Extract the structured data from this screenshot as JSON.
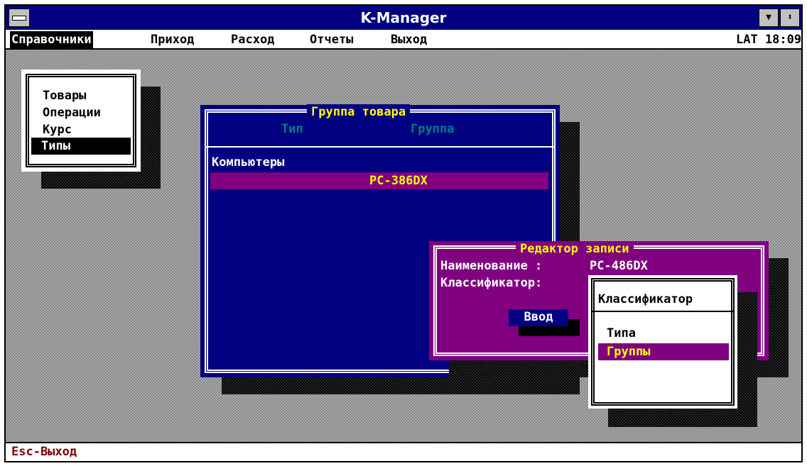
{
  "window": {
    "title": "K-Manager",
    "sys_icon": "system-menu-icon",
    "minimize_icon": "arrow-down-icon",
    "restore_icon": "arrow-updown-icon"
  },
  "menubar": {
    "items": [
      "Справочники",
      "Приход",
      "Расход",
      "Отчеты",
      "Выход"
    ],
    "status": "LAT 18:09"
  },
  "ref_menu": {
    "items": [
      "Товары",
      "Операции",
      "Курс",
      "Типы"
    ],
    "selected": "Типы"
  },
  "group_window": {
    "title": "Группа товара",
    "columns": [
      "Тип",
      "Группа"
    ],
    "rows": [
      {
        "type": "Компьютеры",
        "group": ""
      },
      {
        "type": "",
        "group": "PC-386DX"
      }
    ]
  },
  "editor": {
    "title": "Редактор записи",
    "name_label": "Наименование :",
    "name_value": "PC-486DX",
    "classifier_label": "Классификатор:",
    "enter_button": "Ввод"
  },
  "classifier_popup": {
    "title": "Классификатор",
    "options": [
      "Типа",
      "Группы"
    ],
    "selected": "Группы"
  },
  "statusbar": {
    "text": "Esc-Выход"
  },
  "colors": {
    "title_bar": "#000080",
    "window_blue": "#000080",
    "window_magenta": "#800080",
    "highlight_yellow": "#ffff00",
    "header_cyan": "#008080",
    "status_red": "#800000"
  }
}
